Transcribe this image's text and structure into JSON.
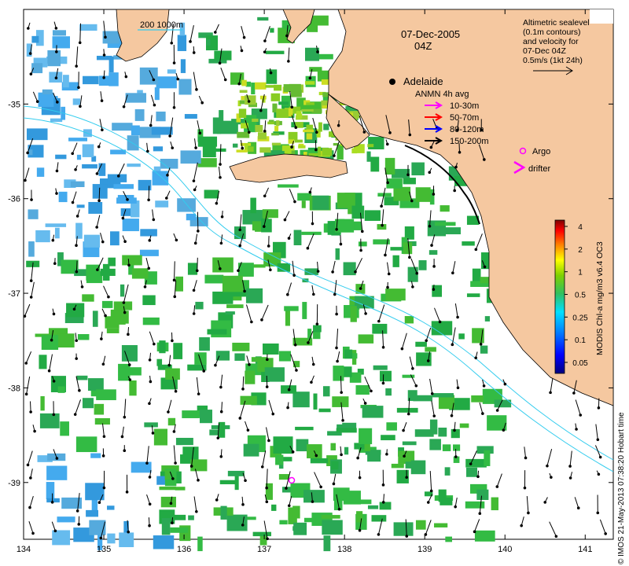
{
  "map": {
    "date_line1": "07-Dec-2005",
    "date_line2": "04Z",
    "scale_bar_label": "200  1000m",
    "city": "Adelaide",
    "x_ticks": [
      "134",
      "135",
      "136",
      "137",
      "138",
      "139",
      "140",
      "141"
    ],
    "y_ticks": [
      "-35",
      "-36",
      "-37",
      "-38",
      "-39"
    ],
    "lon_range": [
      134,
      141.35
    ],
    "lat_range": [
      -39.6,
      -34.0
    ],
    "colors": {
      "land": "#f5c8a0",
      "ocean": "#ffffff",
      "bathymetry": "#33ccee",
      "coast": "#000000"
    }
  },
  "info": {
    "lines": [
      "Altimetric sealevel",
      "(0.1m contours)",
      "and velocity for",
      "07-Dec 04Z",
      "0.5m/s (1kt 24h)"
    ]
  },
  "legend": {
    "title": "ANMN 4h avg",
    "entries": [
      {
        "label": "10-30m",
        "color": "#ff00ff"
      },
      {
        "label": "50-70m",
        "color": "#ff0000"
      },
      {
        "label": "80-120m",
        "color": "#0000ff"
      },
      {
        "label": "150-200m",
        "color": "#000000"
      }
    ],
    "argo_label": "Argo",
    "drifter_label": "drifter",
    "marker_color": "#ff00ff"
  },
  "colorbar": {
    "label": "MODIS Chl-a mg/m3 v6.4 OC3",
    "ticks": [
      "4",
      "2",
      "1",
      "0.5",
      "0.25",
      "0.1",
      "0.05"
    ]
  },
  "credit": "© IMOS 21-May-2013 07:38:20 Hobart time"
}
